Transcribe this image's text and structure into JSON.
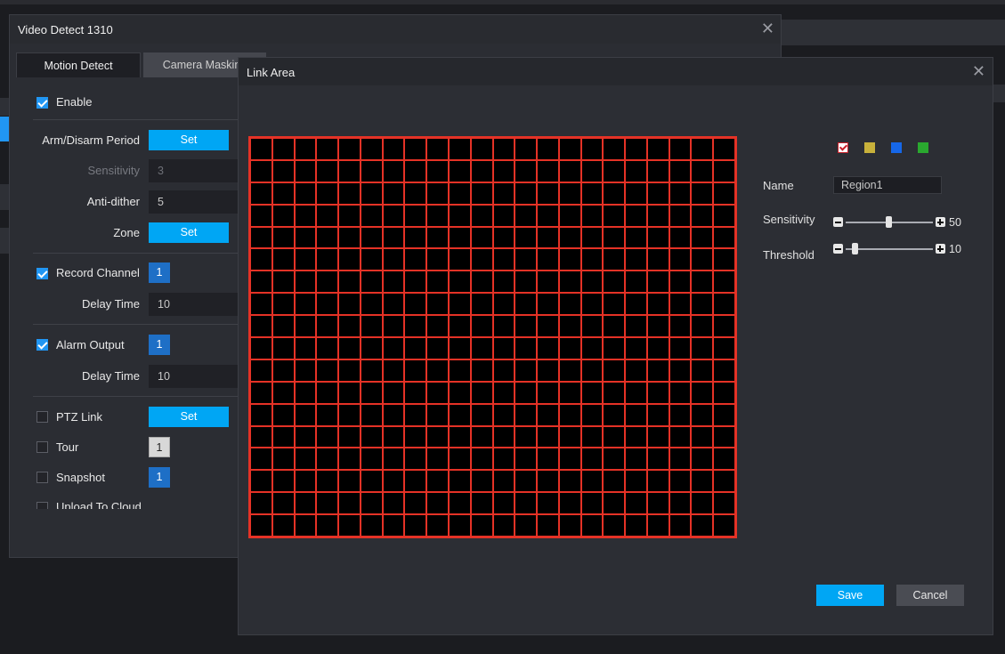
{
  "video_detect": {
    "title": "Video Detect 1310",
    "tabs": [
      "Motion Detect",
      "Camera Masking"
    ],
    "enable_label": "Enable",
    "arm_label": "Arm/Disarm Period",
    "set_label": "Set",
    "sensitivity_label": "Sensitivity",
    "sensitivity_value": "3",
    "antidither_label": "Anti-dither",
    "antidither_value": "5",
    "zone_label": "Zone",
    "record_label": "Record Channel",
    "record_badge": "1",
    "delay_label": "Delay Time",
    "record_delay": "10",
    "alarm_label": "Alarm Output",
    "alarm_badge": "1",
    "alarm_delay": "10",
    "ptz_label": "PTZ Link",
    "tour_label": "Tour",
    "tour_badge": "1",
    "snapshot_label": "Snapshot",
    "snapshot_badge": "1",
    "upload_label": "Upload To Cloud"
  },
  "link_area": {
    "title": "Link Area",
    "name_label": "Name",
    "name_value": "Region1",
    "sensitivity_label": "Sensitivity",
    "sensitivity_value": "50",
    "threshold_label": "Threshold",
    "threshold_value": "10",
    "save_label": "Save",
    "cancel_label": "Cancel",
    "region_colors": [
      "#c8202a",
      "#c8b13b",
      "#1667e8",
      "#2aa82f"
    ],
    "grid_color": "#e53226",
    "close_icon": "close-icon"
  }
}
